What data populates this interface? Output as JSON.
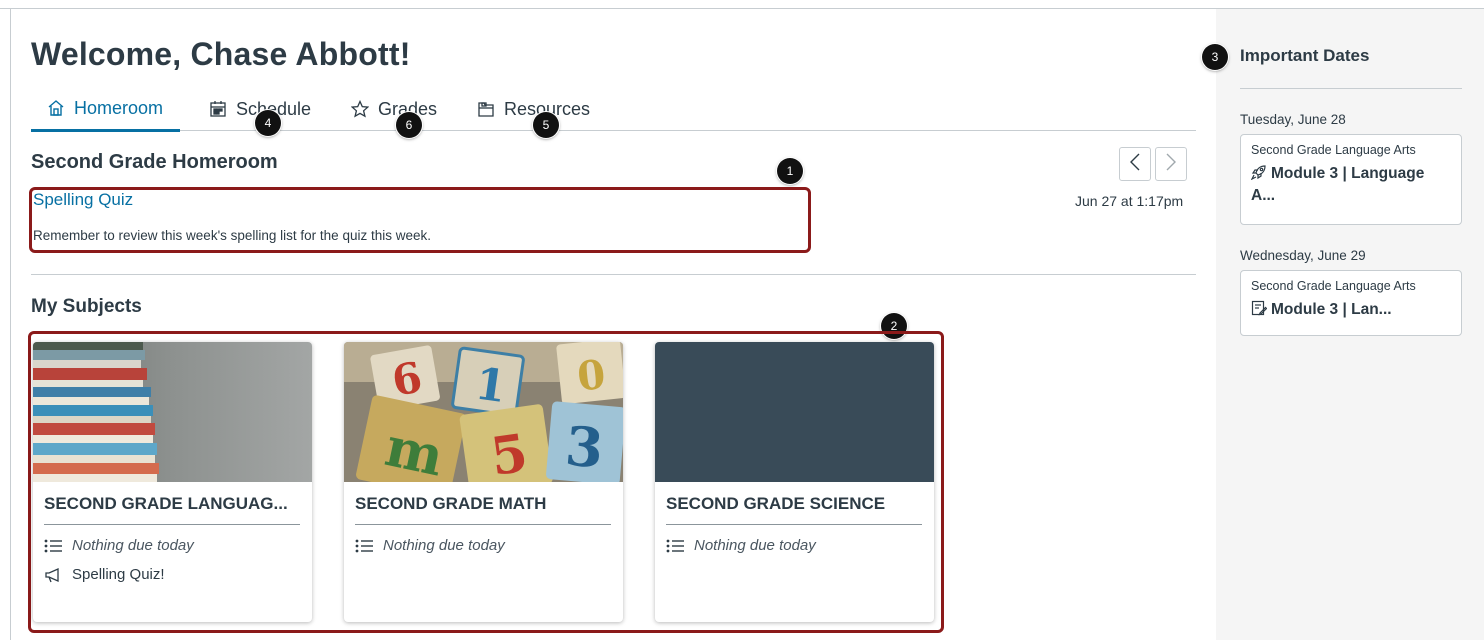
{
  "page": {
    "title": "Welcome, Chase Abbott!"
  },
  "tabs": [
    {
      "label": "Homeroom",
      "icon": "home-icon",
      "active": true
    },
    {
      "label": "Schedule",
      "icon": "calendar-icon",
      "active": false
    },
    {
      "label": "Grades",
      "icon": "star-icon",
      "active": false
    },
    {
      "label": "Resources",
      "icon": "folder-icon",
      "active": false
    }
  ],
  "callouts": [
    "1",
    "2",
    "3",
    "4",
    "5",
    "6"
  ],
  "homeroom": {
    "title": "Second Grade Homeroom",
    "announcement": {
      "title": "Spelling Quiz",
      "body": "Remember to review this week's spelling list for the quiz this week.",
      "date": "Jun 27 at 1:17pm"
    }
  },
  "subjects": {
    "title": "My Subjects",
    "cards": [
      {
        "name": "SECOND GRADE LANGUAG...",
        "status": "Nothing due today",
        "announcement": "Spelling Quiz!",
        "hero": "books-image"
      },
      {
        "name": "SECOND GRADE MATH",
        "status": "Nothing due today",
        "hero": "blocks-image"
      },
      {
        "name": "SECOND GRADE SCIENCE",
        "status": "Nothing due today",
        "hero": "solid-color",
        "hero_color": "#394b58"
      }
    ]
  },
  "sidebar": {
    "title": "Important Dates",
    "groups": [
      {
        "date": "Tuesday, June 28",
        "course": "Second Grade Language Arts",
        "item": "Module 3 | Language A...",
        "icon": "rocket-icon"
      },
      {
        "date": "Wednesday, June 29",
        "course": "Second Grade Language Arts",
        "item": "Module 3 | Lan...",
        "icon": "assignment-icon"
      }
    ]
  },
  "colors": {
    "accent": "#0770a3",
    "callout_border": "#8b1a1a",
    "text": "#2d3b45",
    "sidebar_bg": "#f5f5f5"
  }
}
